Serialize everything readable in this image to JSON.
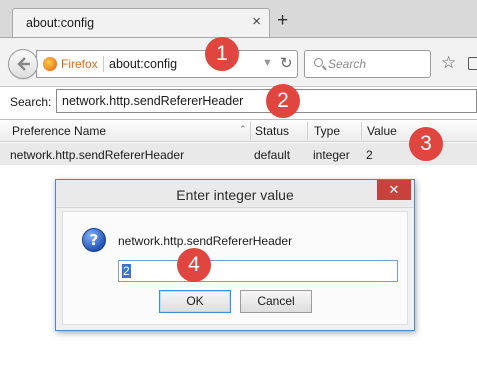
{
  "browser": {
    "tab_title": "about:config",
    "tab_close": "×",
    "new_tab": "+",
    "identity_label": "Firefox",
    "url": "about:config",
    "url_dropdown": "▼",
    "reload": "↻",
    "search_placeholder": "Search",
    "bookmark_star": "☆"
  },
  "filter": {
    "label": "Search:",
    "value": "network.http.sendRefererHeader"
  },
  "table": {
    "headers": [
      "Preference Name",
      "Status",
      "Type",
      "Value"
    ],
    "sort_indicator": "⌃",
    "rows": [
      [
        "network.http.sendRefererHeader",
        "default",
        "integer",
        "2"
      ]
    ]
  },
  "dialog": {
    "title": "Enter integer value",
    "close": "✕",
    "help_glyph": "?",
    "message": "network.http.sendRefererHeader",
    "input_value": "2",
    "ok_label": "OK",
    "cancel_label": "Cancel"
  },
  "annotations": [
    "1",
    "2",
    "3",
    "4"
  ],
  "colors": {
    "badge": "#e0463f",
    "close_button": "#c7423a",
    "selection": "#3374d8",
    "firefox_label": "#e36a1a"
  }
}
